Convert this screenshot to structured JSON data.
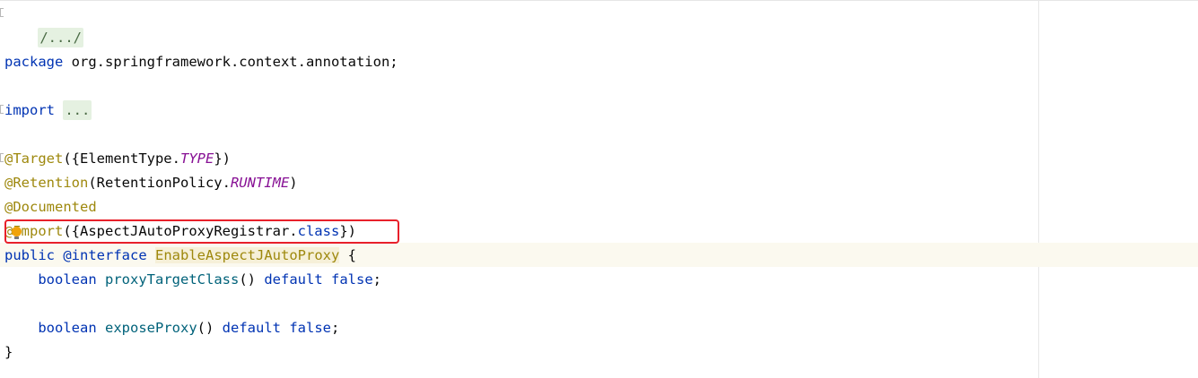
{
  "editor": {
    "lines": {
      "folded_header": "/.../",
      "package_kw": "package",
      "package_name": "org.springframework.context.annotation;",
      "import_kw": "import",
      "import_folded": "...",
      "target_ann": "@Target",
      "target_open": "({ElementType.",
      "target_const": "TYPE",
      "target_close": "})",
      "retention_ann": "@Retention",
      "retention_open": "(RetentionPolicy.",
      "retention_const": "RUNTIME",
      "retention_close": ")",
      "documented_ann": "@Documented",
      "import_ann_at": "@",
      "import_ann_name": "Import",
      "import_args_open": "({AspectJAutoProxyRegistrar.",
      "import_args_class": "class",
      "import_args_close": "})",
      "public_kw": "public",
      "interface_kw": "@interface",
      "interface_name": "EnableAspectJAutoProxy",
      "interface_brace": " {",
      "boolean_kw_1": "boolean",
      "method_1": "proxyTargetClass",
      "method_1_parens": "()",
      "default_kw_1": "default",
      "false_kw_1": "false",
      "semicolon_1": ";",
      "boolean_kw_2": "boolean",
      "method_2": "exposeProxy",
      "method_2_parens": "()",
      "default_kw_2": "default",
      "false_kw_2": "false",
      "semicolon_2": ";",
      "closing_brace": "}"
    }
  },
  "colors": {
    "keyword": "#0033b3",
    "annotation": "#9e880d",
    "constant": "#871094",
    "method": "#00627a",
    "highlight_border": "#e8202a",
    "current_line_bg": "#fbf9ef",
    "intention_bulb": "#f0a30a"
  },
  "icons": {
    "intention": "lightbulb-icon",
    "fold": "fold-marker-icon"
  }
}
